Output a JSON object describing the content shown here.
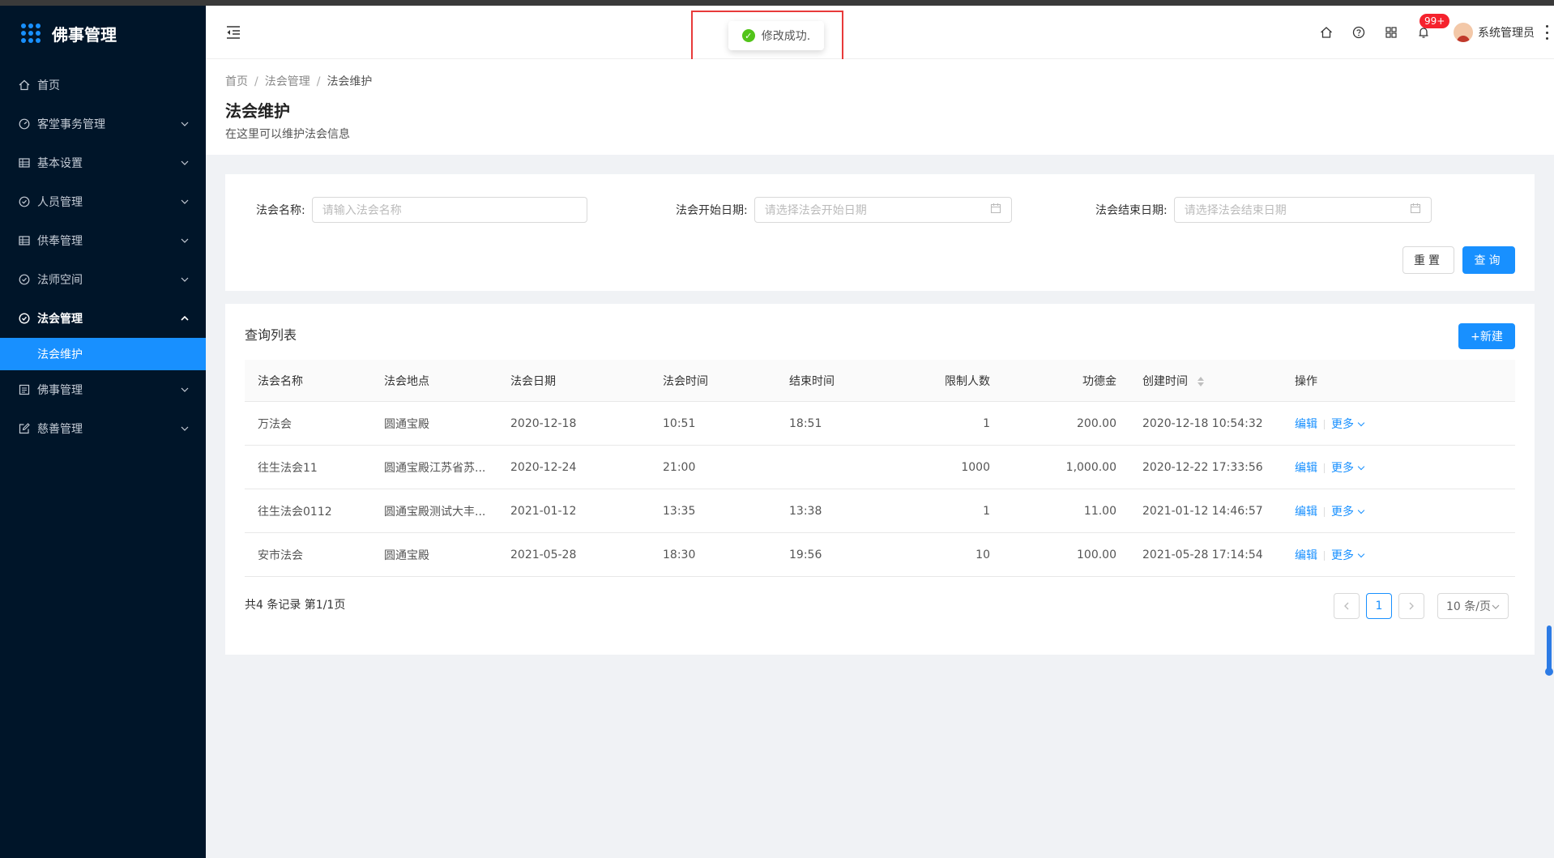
{
  "app": {
    "title": "佛事管理"
  },
  "sidebar": {
    "items": [
      {
        "label": "首页",
        "icon": "home-icon"
      },
      {
        "label": "客堂事务管理",
        "icon": "dashboard-icon"
      },
      {
        "label": "基本设置",
        "icon": "table-icon"
      },
      {
        "label": "人员管理",
        "icon": "check-circle-icon"
      },
      {
        "label": "供奉管理",
        "icon": "table-icon"
      },
      {
        "label": "法师空间",
        "icon": "check-circle-icon"
      },
      {
        "label": "法会管理",
        "icon": "check-circle-icon",
        "open": true
      },
      {
        "label": "佛事管理",
        "icon": "profile-icon"
      },
      {
        "label": "慈善管理",
        "icon": "form-icon"
      }
    ],
    "sub_item": {
      "label": "法会维护"
    }
  },
  "header": {
    "notification_count": "99+",
    "user_name": "系统管理员"
  },
  "toast": {
    "message": "修改成功."
  },
  "breadcrumb": {
    "items": [
      "首页",
      "法会管理",
      "法会维护"
    ]
  },
  "page": {
    "title": "法会维护",
    "description": "在这里可以维护法会信息"
  },
  "search": {
    "name_label": "法会名称:",
    "name_placeholder": "请输入法会名称",
    "start_label": "法会开始日期:",
    "start_placeholder": "请选择法会开始日期",
    "end_label": "法会结束日期:",
    "end_placeholder": "请选择法会结束日期",
    "reset_label": "重置",
    "query_label": "查询"
  },
  "table": {
    "card_title": "查询列表",
    "new_label": "+新建",
    "columns": [
      "法会名称",
      "法会地点",
      "法会日期",
      "法会时间",
      "结束时间",
      "限制人数",
      "功德金",
      "创建时间",
      "操作"
    ],
    "rows": [
      [
        "万法会",
        "圆通宝殿",
        "2020-12-18",
        "10:51",
        "18:51",
        "1",
        "200.00",
        "2020-12-18 10:54:32"
      ],
      [
        "往生法会11",
        "圆通宝殿江苏省苏...",
        "2020-12-24",
        "21:00",
        "",
        "1000",
        "1,000.00",
        "2020-12-22 17:33:56"
      ],
      [
        "往生法会0112",
        "圆通宝殿测试大丰...",
        "2021-01-12",
        "13:35",
        "13:38",
        "1",
        "11.00",
        "2021-01-12 14:46:57"
      ],
      [
        "安市法会",
        "圆通宝殿",
        "2021-05-28",
        "18:30",
        "19:56",
        "10",
        "100.00",
        "2021-05-28 17:14:54"
      ]
    ],
    "edit_label": "编辑",
    "more_label": "更多"
  },
  "pagination": {
    "summary": "共4 条记录 第1/1页",
    "current_page": "1",
    "page_size": "10 条/页"
  },
  "colors": {
    "primary": "#1890ff",
    "sidebar_bg": "#001529",
    "success": "#52c41a",
    "badge": "#f5222d"
  }
}
